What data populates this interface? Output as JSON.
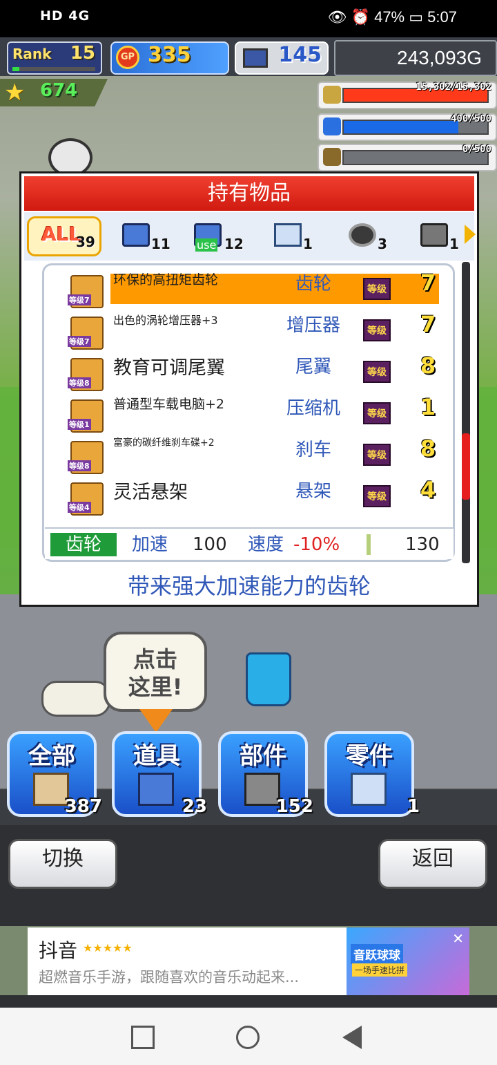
{
  "status_bar": {
    "left": "HD 4G",
    "battery": "47%",
    "time": "5:07"
  },
  "hud": {
    "rank_label": "Rank",
    "rank_value": "15",
    "gp_label": "GP",
    "gp_value": "335",
    "computer_value": "145",
    "money": "243,093G",
    "star_value": "674",
    "meters": [
      {
        "value": "15,302/15,302",
        "fill": 1.0,
        "color": "#ff3a1a",
        "icon_color": "#c9a640"
      },
      {
        "value": "400/500",
        "fill": 0.8,
        "color": "#1a6ae8",
        "icon_color": "#2a70e0"
      },
      {
        "value": "0/500",
        "fill": 0.0,
        "color": "#6a9a2a",
        "icon_color": "#8a6a2a"
      }
    ]
  },
  "dialog": {
    "title": "持有物品",
    "tabs": [
      {
        "label": "ALL",
        "count": "39"
      },
      {
        "label": "",
        "count": "11",
        "icon": "blue-box-icon"
      },
      {
        "label": "use",
        "count": "12",
        "icon": "use-box-icon"
      },
      {
        "label": "",
        "count": "1",
        "icon": "car-card-icon"
      },
      {
        "label": "",
        "count": "3",
        "icon": "tire-icon"
      },
      {
        "label": "",
        "count": "1",
        "icon": "engine-icon"
      }
    ],
    "items": [
      {
        "name": "环保的高扭矩齿轮",
        "category": "齿轮",
        "badge": "等级",
        "level": "7",
        "thumb_level": "等级7",
        "name_size": "19px"
      },
      {
        "name": "出色的涡轮增压器+3",
        "category": "增压器",
        "badge": "等级",
        "level": "7",
        "thumb_level": "等级7",
        "name_size": "16px"
      },
      {
        "name": "教育可调尾翼",
        "category": "尾翼",
        "badge": "等级",
        "level": "8",
        "thumb_level": "等级8",
        "name_size": "27px"
      },
      {
        "name": "普通型车载电脑+2",
        "category": "压缩机",
        "badge": "等级",
        "level": "1",
        "thumb_level": "等级1",
        "name_size": "19px"
      },
      {
        "name": "富豪的碳纤维刹车碟+2",
        "category": "刹车",
        "badge": "等级",
        "level": "8",
        "thumb_level": "等级8",
        "name_size": "14px"
      },
      {
        "name": "灵活悬架",
        "category": "悬架",
        "badge": "等级",
        "level": "4",
        "thumb_level": "等级4",
        "name_size": "27px"
      }
    ],
    "stats": {
      "kind": "齿轮",
      "accel_label": "加速",
      "accel_value": "100",
      "speed_label": "速度",
      "speed_value": "-10%",
      "last_value": "130"
    },
    "description": "带来强大加速能力的齿轮"
  },
  "tutorial": {
    "line1": "点击",
    "line2": "这里!"
  },
  "categories": [
    {
      "label": "全部",
      "count": "387"
    },
    {
      "label": "道具",
      "count": "23"
    },
    {
      "label": "部件",
      "count": "152"
    },
    {
      "label": "零件",
      "count": "1"
    }
  ],
  "buttons": {
    "switch": "切换",
    "back": "返回"
  },
  "ad": {
    "title": "抖音",
    "stars": "★★★★★",
    "desc": "超燃音乐手游，跟随喜欢的音乐动起来...",
    "banner_title": "音跃球球",
    "banner_sub": "一场手速比拼",
    "close": "✕"
  }
}
